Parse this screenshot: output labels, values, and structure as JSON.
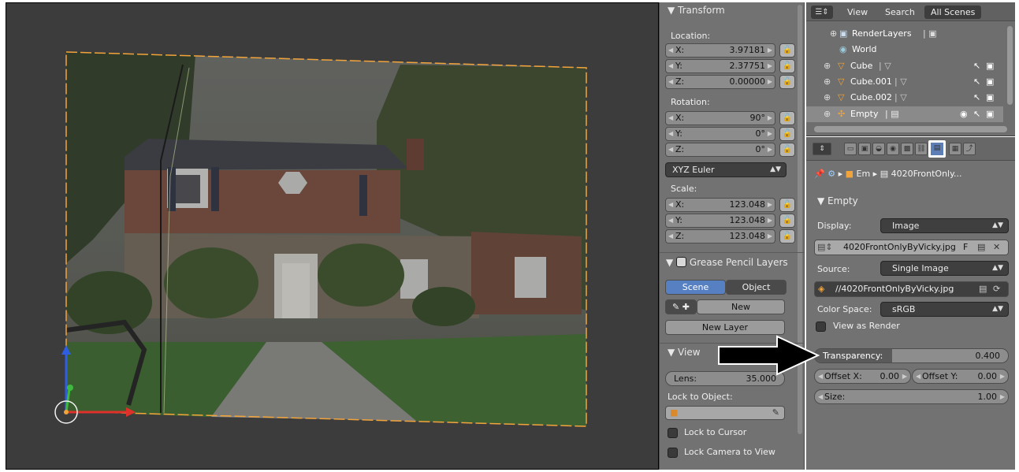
{
  "colors": {
    "panel_bg": "#727272",
    "viewport_bg": "#3c3c3c",
    "active_blue": "#5680c2",
    "selection_orange": "#f2a43c"
  },
  "transform": {
    "header": "▼ Transform",
    "location_label": "Location:",
    "loc_x_label": "X:",
    "loc_x": "3.97181",
    "loc_y_label": "Y:",
    "loc_y": "2.37751",
    "loc_z_label": "Z:",
    "loc_z": "0.00000",
    "rotation_label": "Rotation:",
    "rot_x_label": "X:",
    "rot_x": "90°",
    "rot_y_label": "Y:",
    "rot_y": "0°",
    "rot_z_label": "Z:",
    "rot_z": "0°",
    "rotation_mode": "XYZ Euler",
    "scale_label": "Scale:",
    "scale_x_label": "X:",
    "scale_x": "123.048",
    "scale_y_label": "Y:",
    "scale_y": "123.048",
    "scale_z_label": "Z:",
    "scale_z": "123.048"
  },
  "grease_pencil": {
    "header": "Grease Pencil Layers",
    "scene_tab": "Scene",
    "object_tab": "Object",
    "new_button": "New",
    "new_layer_button": "New Layer"
  },
  "view": {
    "header": "▼ View",
    "lens_label": "Lens:",
    "lens_value": "35.000",
    "lock_to_object_label": "Lock to Object:",
    "lock_to_cursor": "Lock to Cursor",
    "lock_camera_to_view": "Lock Camera to View"
  },
  "outliner": {
    "tabs": [
      "View",
      "Search",
      "All Scenes"
    ],
    "rows": [
      {
        "name": "RenderLayers",
        "icon": "renderlayers-icon"
      },
      {
        "name": "World",
        "icon": "world-icon"
      },
      {
        "name": "Cube",
        "icon": "mesh-icon"
      },
      {
        "name": "Cube.001",
        "icon": "mesh-icon"
      },
      {
        "name": "Cube.002",
        "icon": "mesh-icon"
      },
      {
        "name": "Empty",
        "icon": "empty-icon"
      }
    ]
  },
  "properties": {
    "breadcrumb_obj": "Em",
    "breadcrumb_data": "4020FrontOnly...",
    "empty_header": "▼ Empty",
    "display_label": "Display:",
    "display_value": "Image",
    "image_name": "4020FrontOnlyByVicky.jpg",
    "image_f": "F",
    "source_label": "Source:",
    "source_value": "Single Image",
    "filepath": "//4020FrontOnlyByVicky.jpg",
    "color_space_label": "Color Space:",
    "color_space_value": "sRGB",
    "view_as_render": "View as Render",
    "transparency_label": "Transparency:",
    "transparency_value": "0.400",
    "transparency_fraction": 0.4,
    "offset_x_label": "Offset X:",
    "offset_x_value": "0.00",
    "offset_y_label": "Offset Y:",
    "offset_y_value": "0.00",
    "size_label": "Size:",
    "size_value": "1.00"
  }
}
